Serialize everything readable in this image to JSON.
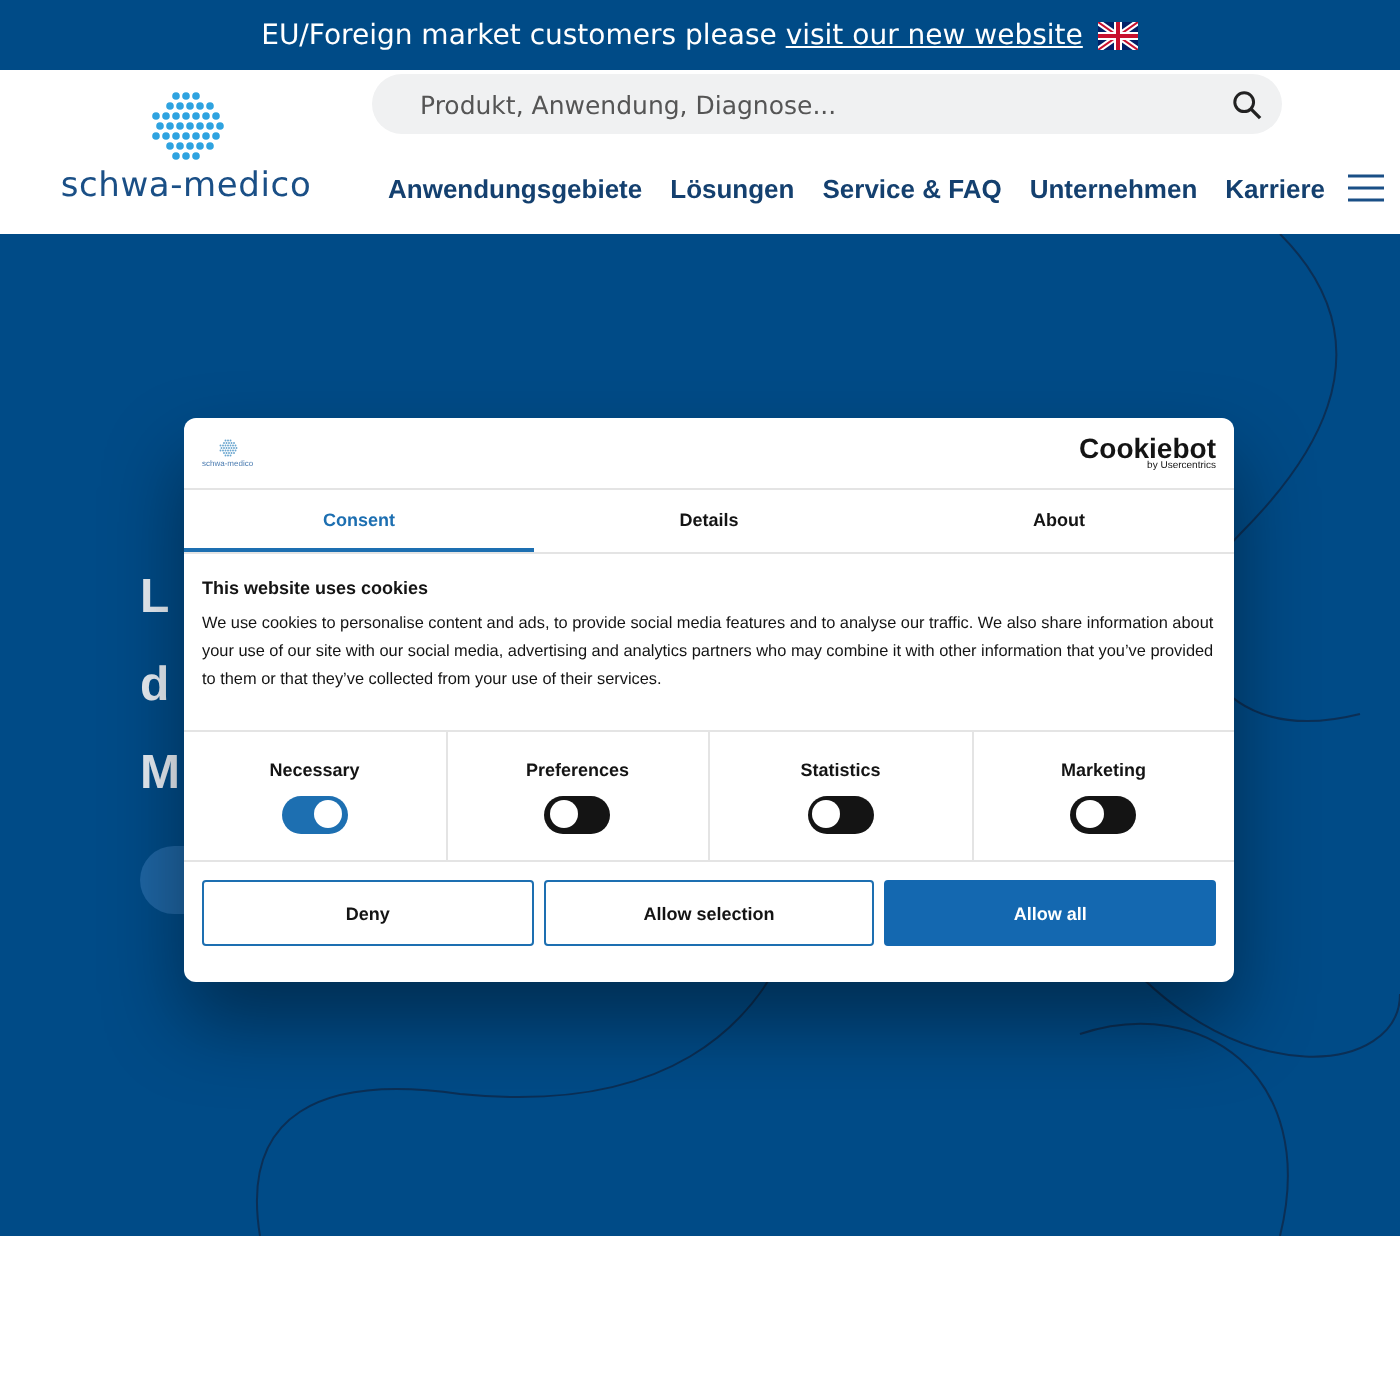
{
  "top_bar": {
    "text": "EU/Foreign market customers please ",
    "link": "visit our new website"
  },
  "header": {
    "logo_text": "schwa-medico",
    "search": {
      "placeholder": "Produkt, Anwendung, Diagnose..."
    },
    "nav": [
      "Anwendungsgebiete",
      "Lösungen",
      "Service & FAQ",
      "Unternehmen",
      "Karriere"
    ]
  },
  "hero": {
    "heading_lines": [
      "L",
      "d",
      "M"
    ]
  },
  "cookie_dialog": {
    "logo_text": "schwa-medico",
    "brand": "Cookiebot",
    "brand_sub": "by Usercentrics",
    "tabs": [
      {
        "label": "Consent",
        "selected": true
      },
      {
        "label": "Details",
        "selected": false
      },
      {
        "label": "About",
        "selected": false
      }
    ],
    "title": "This website uses cookies",
    "body": "We use cookies to personalise content and ads, to provide social media features and to analyse our traffic. We also share information about your use of our site with our social media, advertising and analytics partners who may combine it with other information that you’ve provided to them or that they’ve collected from your use of their services.",
    "categories": [
      {
        "label": "Necessary",
        "on": true
      },
      {
        "label": "Preferences",
        "on": false
      },
      {
        "label": "Statistics",
        "on": false
      },
      {
        "label": "Marketing",
        "on": false
      }
    ],
    "buttons": [
      {
        "label": "Deny",
        "kind": "outline"
      },
      {
        "label": "Allow selection",
        "kind": "outline"
      },
      {
        "label": "Allow all",
        "kind": "primary"
      }
    ]
  }
}
